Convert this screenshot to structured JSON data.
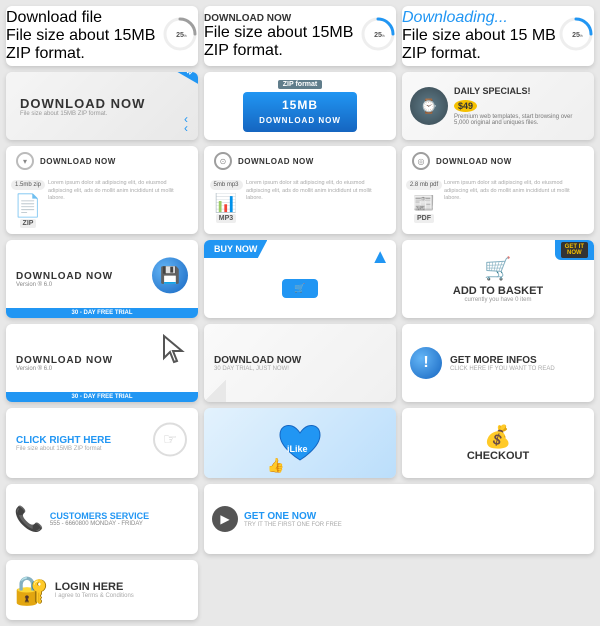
{
  "colors": {
    "blue": "#2196F3",
    "darkBlue": "#1565c0",
    "gray": "#607d8b",
    "yellow": "#f5c000",
    "lightBg": "#e8e8e8"
  },
  "row1": [
    {
      "title": "Download file",
      "sub": "File size  about 15MB ZIP format.",
      "percent": 25,
      "ring_color": "#9e9e9e"
    },
    {
      "title": "DOWNLOAD NOW",
      "sub": "File size  about 15MB ZIP format.",
      "percent": 25,
      "ring_color": "#2196F3"
    },
    {
      "title": "Downloading...",
      "sub": "File size about 15 MB ZIP format.",
      "percent": 25,
      "ring_color": "#2196F3"
    }
  ],
  "row2": {
    "big": {
      "title": "DOWNLOAD NOW",
      "sub": "File size about 15MB ZIP format.",
      "ribbon": "New"
    },
    "zip": {
      "badge": "ZIP format",
      "size": "15MB",
      "btn": "DOWNLOAD NOW"
    },
    "daily": {
      "title": "DAILY SPECIALS!",
      "price": "$49",
      "sub": "Premium web templates, start browsing over 5,000 original and uniques files."
    }
  },
  "row3": [
    {
      "label": "DOWNLOAD NOW",
      "tag": "1.5mb zip",
      "type": "ZIP",
      "icon": "📄"
    },
    {
      "label": "DOWNLOAD NOW",
      "tag": "5mb mp3",
      "type": "MP3",
      "icon": "🎵"
    },
    {
      "label": "DOWNLOAD NOW",
      "tag": "2.8 mb pdf",
      "type": "PDF",
      "icon": "📰"
    }
  ],
  "row4": {
    "left": {
      "title": "DOWNLOAD NOW",
      "version": "Version ® 6.0",
      "trial": "30 - DAY FREE TRIAL"
    },
    "mid": {
      "ribbon": "BUY NOW",
      "sub": ""
    },
    "center": {
      "title": "ADD TO BASKET",
      "sub": "currently you have 0 item",
      "badge": "GET IT NOW"
    },
    "right": {
      "title": "DOWNLOAD NOW",
      "version": "Version ® 6.0",
      "trial": "30 - DAY FREE TRIAL"
    }
  },
  "row5": {
    "left": {
      "title": "DOWNLOAD NOW",
      "sub": "30 DAY TRIAL, JUST NOW!"
    },
    "mid": {
      "title": "GET MORE INFOS",
      "sub": "CLICK HERE IF YOU WANT TO READ"
    },
    "right": {
      "title": "CLICK RIGHT HERE",
      "sub": "File size about 15MB ZIP format"
    }
  },
  "row6": {
    "left": {
      "label": "iLike"
    },
    "mid": {
      "title": "CHECKOUT"
    },
    "right": {
      "title": "CUSTOMERS SERVICE",
      "phone": "555 - 6660800 MONDAY - FRIDAY"
    }
  },
  "row7": {
    "get": {
      "title_part1": "GET ",
      "highlight": "ONE",
      "title_part2": " NOW",
      "sub": "TRY IT THE FIRST ONE FOR FREE"
    },
    "login": {
      "title": "LOGIN HERE",
      "sub": "I agree to Terms & Conditions"
    }
  }
}
